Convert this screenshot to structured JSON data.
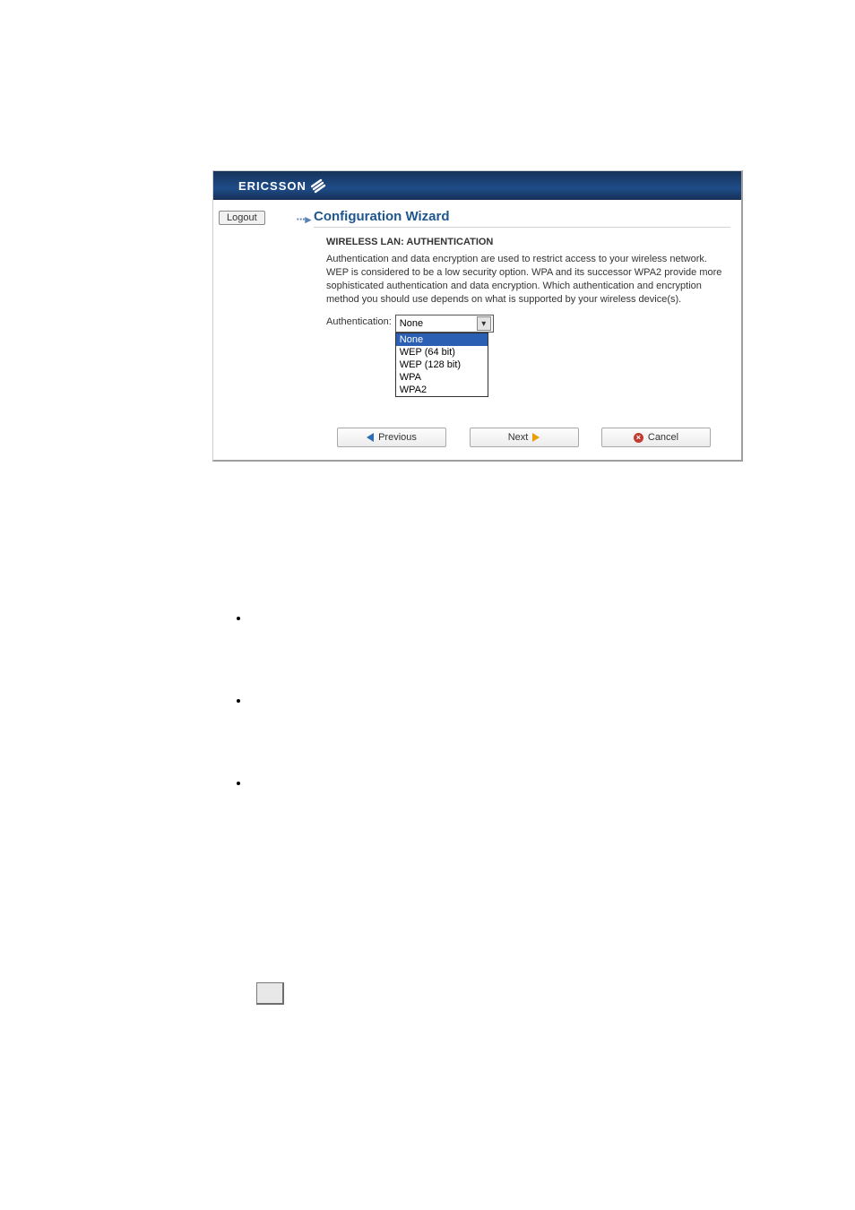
{
  "banner": {
    "brand": "ERICSSON"
  },
  "sidebar": {
    "logout_label": "Logout"
  },
  "wizard": {
    "title": "Configuration Wizard",
    "subtitle": "WIRELESS LAN: AUTHENTICATION",
    "description": "Authentication and data encryption are used to restrict access to your wireless network. WEP is considered to be a low security option. WPA and its successor WPA2 provide more sophisticated authentication and data encryption.\nWhich authentication and encryption method you should use depends on what is supported by your wireless device(s).",
    "auth_label": "Authentication:",
    "auth_selected": "None",
    "auth_options": [
      "None",
      "WEP (64 bit)",
      "WEP (128 bit)",
      "WPA",
      "WPA2"
    ],
    "buttons": {
      "previous": "Previous",
      "next": "Next",
      "cancel": "Cancel"
    }
  }
}
